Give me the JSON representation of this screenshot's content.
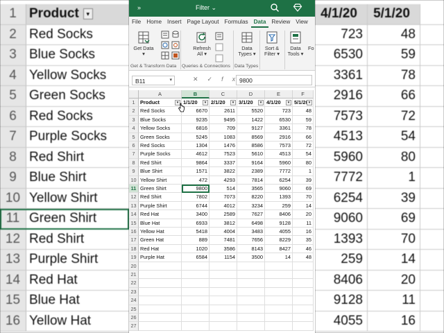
{
  "titlebar": {
    "more_label": "»",
    "title": "Filter ⌄"
  },
  "tabs": [
    "File",
    "Home",
    "Insert",
    "Page Layout",
    "Formulas",
    "Data",
    "Review",
    "View"
  ],
  "active_tab": "Data",
  "ribbon": {
    "get_data": "Get Data ▾",
    "refresh_all": "Refresh All ▾",
    "data_types": "Data Types ▾",
    "sort_filter": "Sort & Filter ▾",
    "data_tools": "Data Tools ▾",
    "fo": "Fo",
    "group_get_transform": "Get & Transform Data",
    "group_queries": "Queries & Connections",
    "group_data_types": "Data Types"
  },
  "formula_bar": {
    "name_box": "B11",
    "value": "9800"
  },
  "columns": [
    "A",
    "B",
    "C",
    "D",
    "E",
    "F"
  ],
  "selected_column": "B",
  "selected_row": 11,
  "header_row": [
    "Product",
    "1/1/20",
    "2/1/20",
    "3/1/20",
    "4/1/20",
    "5/1/20"
  ],
  "rows": [
    [
      "Red Socks",
      "6670",
      "2611",
      "5520",
      "723",
      "48"
    ],
    [
      "Blue Socks",
      "9235",
      "9495",
      "1422",
      "6530",
      "59"
    ],
    [
      "Yellow Socks",
      "6816",
      "709",
      "9127",
      "3361",
      "78"
    ],
    [
      "Green Socks",
      "5245",
      "1083",
      "8569",
      "2916",
      "66"
    ],
    [
      "Red Socks",
      "1304",
      "1476",
      "8586",
      "7573",
      "72"
    ],
    [
      "Purple Socks",
      "4612",
      "7523",
      "5610",
      "4513",
      "54"
    ],
    [
      "Red Shirt",
      "9864",
      "3337",
      "9164",
      "5960",
      "80"
    ],
    [
      "Blue Shirt",
      "1571",
      "3822",
      "2389",
      "7772",
      "1"
    ],
    [
      "Yellow Shirt",
      "472",
      "4293",
      "7814",
      "6254",
      "39"
    ],
    [
      "Green Shirt",
      "9800",
      "514",
      "3565",
      "9060",
      "69"
    ],
    [
      "Red Shirt",
      "7802",
      "7073",
      "8220",
      "1393",
      "70"
    ],
    [
      "Purple Shirt",
      "6744",
      "4012",
      "3234",
      "259",
      "14"
    ],
    [
      "Red Hat",
      "3400",
      "2589",
      "7627",
      "8406",
      "20"
    ],
    [
      "Blue Hat",
      "6933",
      "3812",
      "6498",
      "9128",
      "11"
    ],
    [
      "Yellow Hat",
      "5418",
      "4004",
      "3483",
      "4055",
      "16"
    ],
    [
      "Green Hat",
      "889",
      "7481",
      "7656",
      "8229",
      "35"
    ],
    [
      "Red Hat",
      "1020",
      "3586",
      "8143",
      "8427",
      "46"
    ],
    [
      "Purple Hat",
      "6584",
      "1154",
      "3500",
      "14",
      "48"
    ]
  ],
  "total_rows_shown": 27,
  "background": {
    "left_rows": [
      {
        "num": "1",
        "text": "Product"
      },
      {
        "num": "2",
        "text": "Red Socks"
      },
      {
        "num": "3",
        "text": "Blue Socks"
      },
      {
        "num": "4",
        "text": "Yellow Socks"
      },
      {
        "num": "5",
        "text": "Green Socks"
      },
      {
        "num": "6",
        "text": "Red Socks"
      },
      {
        "num": "7",
        "text": "Purple Socks"
      },
      {
        "num": "8",
        "text": "Red Shirt"
      },
      {
        "num": "9",
        "text": "Blue Shirt"
      },
      {
        "num": "10",
        "text": "Yellow Shirt"
      },
      {
        "num": "11",
        "text": "Green Shirt"
      },
      {
        "num": "12",
        "text": "Red Shirt"
      },
      {
        "num": "13",
        "text": "Purple Shirt"
      },
      {
        "num": "14",
        "text": "Red Hat"
      },
      {
        "num": "15",
        "text": "Blue Hat"
      },
      {
        "num": "16",
        "text": "Yellow Hat"
      }
    ],
    "right_rows": [
      [
        "4/1/20",
        "5/1/20"
      ],
      [
        "723",
        "48"
      ],
      [
        "6530",
        "59"
      ],
      [
        "3361",
        "78"
      ],
      [
        "2916",
        "66"
      ],
      [
        "7573",
        "72"
      ],
      [
        "4513",
        "54"
      ],
      [
        "5960",
        "80"
      ],
      [
        "7772",
        "1"
      ],
      [
        "6254",
        "39"
      ],
      [
        "9060",
        "69"
      ],
      [
        "1393",
        "70"
      ],
      [
        "259",
        "14"
      ],
      [
        "8406",
        "20"
      ],
      [
        "9128",
        "11"
      ],
      [
        "4055",
        "16"
      ]
    ]
  },
  "colors": {
    "accent": "#1e7145"
  }
}
